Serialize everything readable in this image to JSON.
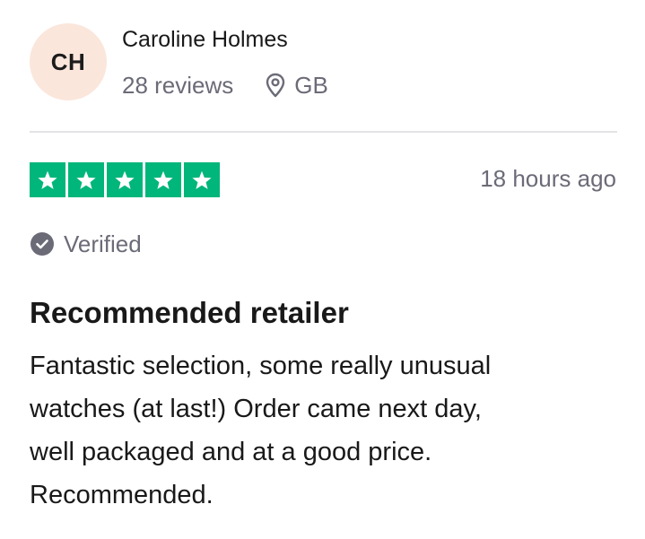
{
  "reviewer": {
    "initials": "CH",
    "name": "Caroline Holmes",
    "review_count": "28 reviews",
    "country": "GB",
    "avatar_color": "#fbe6dc"
  },
  "rating": {
    "stars": 5,
    "max": 5,
    "star_color": "#00b67a"
  },
  "date": "18 hours ago",
  "verified_label": "Verified",
  "review": {
    "title": "Recommended retailer",
    "body_lines": [
      "Fantastic selection, some really unusual",
      "watches (at last!) Order came next day,",
      "well packaged and at a good price.",
      "Recommended."
    ]
  },
  "icons": {
    "location": "location-pin-icon",
    "verified": "check-circle-icon",
    "star": "star-icon"
  }
}
